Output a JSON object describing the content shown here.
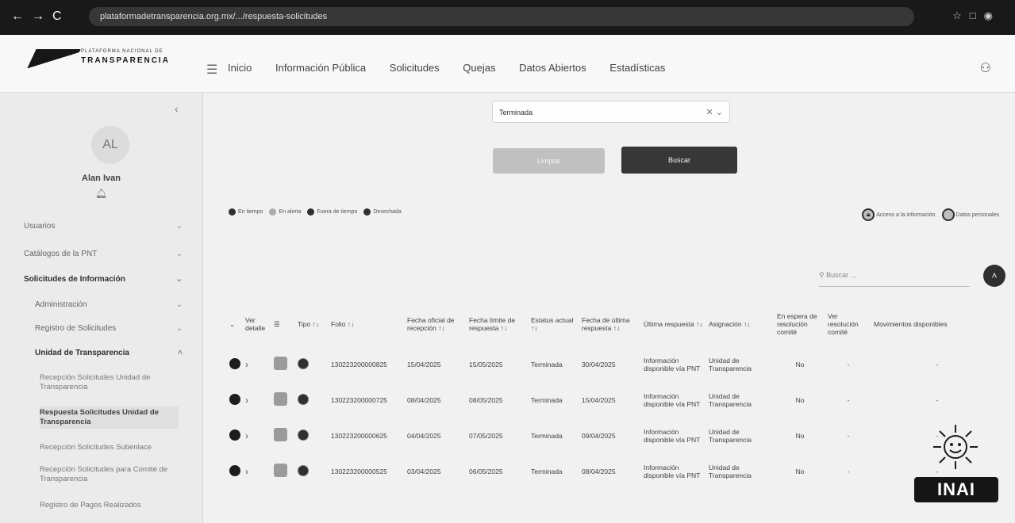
{
  "browser": {
    "url": "plataformadetransparencia.org.mx/.../respuesta-solicitudes"
  },
  "logo": {
    "small": "PLATAFORMA NACIONAL DE",
    "big": "TRANSPARENCIA"
  },
  "menu": [
    "Inicio",
    "Información Pública",
    "Solicitudes",
    "Quejas",
    "Datos Abiertos",
    "Estadísticas"
  ],
  "sidebar": {
    "avatar": "AL",
    "user_name": "Alan Ivan",
    "items": [
      {
        "label": "Usuarios",
        "bold": false
      },
      {
        "label": "Catálogos de la PNT",
        "bold": false
      },
      {
        "label": "Solicitudes de Información",
        "bold": true
      },
      {
        "label": "Administración",
        "bold": false
      },
      {
        "label": "Registro de Solicitudes",
        "bold": false
      },
      {
        "label": "Unidad de Transparencia",
        "bold": true
      }
    ],
    "subitems": [
      {
        "label": "Recepción Solicitudes Unidad de Transparencia",
        "active": false
      },
      {
        "label": "Respuesta Solicitudes Unidad de Transparencia",
        "active": true
      },
      {
        "label": "Recepción Solicitudes Subenlace",
        "active": false
      },
      {
        "label": "Recepción Solicitudes para Comité de Transparencia",
        "active": false
      },
      {
        "label": "Registro de Pagos Realizados",
        "active": false
      }
    ]
  },
  "filter": {
    "status_value": "Terminada",
    "clear_label": "Limpiar",
    "search_label": "Buscar"
  },
  "legend": [
    "En tiempo",
    "En alerta",
    "Fuera de tiempo",
    "Desechada"
  ],
  "legend_right": [
    "Acceso a la información",
    "Datos personales"
  ],
  "search": {
    "placeholder": "Buscar ..."
  },
  "table": {
    "headers": [
      "Ver detalle",
      "",
      "Tipo ↑↓",
      "Folio ↑↓",
      "Fecha oficial de recepción ↑↓",
      "Fecha límite de respuesta ↑↓",
      "Estatus actual ↑↓",
      "Fecha de última respuesta ↑↓",
      "Última respuesta ↑↓",
      "Asignación ↑↓",
      "En espera de resolución comité",
      "Ver resolución comité",
      "Movimientos disponibles"
    ],
    "rows": [
      {
        "folio": "130223200000825",
        "recepcion": "15/04/2025",
        "limite": "15/05/2025",
        "estatus": "Terminada",
        "ultima": "30/04/2025",
        "respuesta": "Información disponible vía PNT",
        "asignacion": "Unidad de Transparencia",
        "comite": "No",
        "ver": "-",
        "mov": "-"
      },
      {
        "folio": "130223200000725",
        "recepcion": "08/04/2025",
        "limite": "08/05/2025",
        "estatus": "Terminada",
        "ultima": "15/04/2025",
        "respuesta": "Información disponible vía PNT",
        "asignacion": "Unidad de Transparencia",
        "comite": "No",
        "ver": "-",
        "mov": "-"
      },
      {
        "folio": "130223200000625",
        "recepcion": "04/04/2025",
        "limite": "07/05/2025",
        "estatus": "Terminada",
        "ultima": "09/04/2025",
        "respuesta": "Información disponible vía PNT",
        "asignacion": "Unidad de Transparencia",
        "comite": "No",
        "ver": "-",
        "mov": "-"
      },
      {
        "folio": "130223200000525",
        "recepcion": "03/04/2025",
        "limite": "06/05/2025",
        "estatus": "Terminada",
        "ultima": "08/04/2025",
        "respuesta": "Información disponible vía PNT",
        "asignacion": "Unidad de Transparencia",
        "comite": "No",
        "ver": "-",
        "mov": "-"
      }
    ]
  },
  "inai": {
    "label": "INAI"
  }
}
